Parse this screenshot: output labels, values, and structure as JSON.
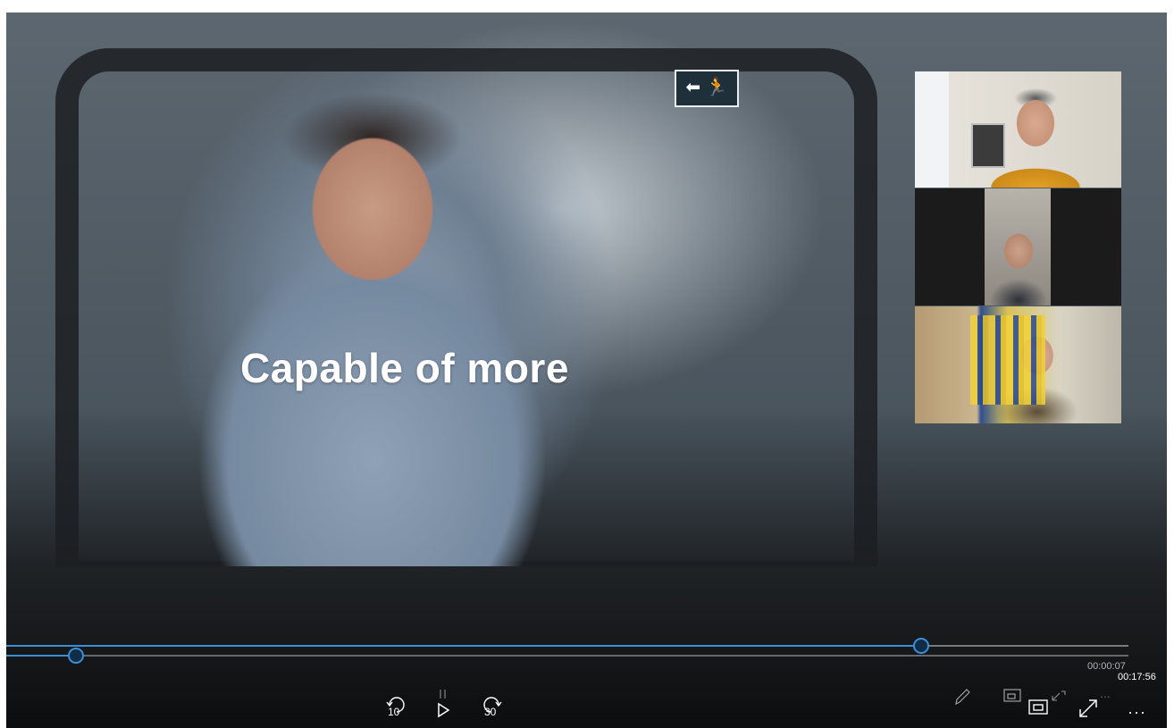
{
  "video": {
    "caption": "Capable of more",
    "exit_sign": "⬅ 🏃",
    "progress_fraction": 0.0066,
    "buffer_fraction": 0.815
  },
  "player": {
    "elapsed_time": "00:00:07",
    "total_time": "00:17:56",
    "rewind_seconds": "10",
    "forward_seconds": "30",
    "more_label": "..."
  },
  "participants": {
    "count": 3
  },
  "colors": {
    "accent": "#3a8fd6",
    "thumb_fill": "#0f2d47"
  }
}
